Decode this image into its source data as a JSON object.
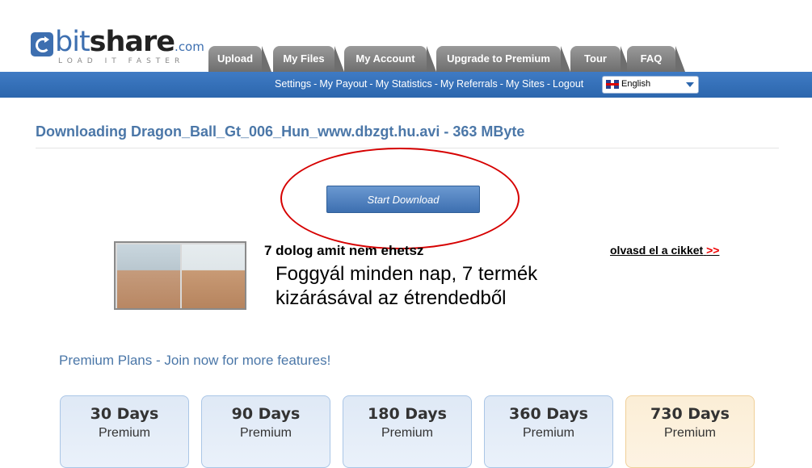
{
  "logo": {
    "light": "bit",
    "strong": "share",
    "domain": ".com",
    "tagline": "LOAD IT FASTER"
  },
  "tabs": [
    {
      "label": "Upload"
    },
    {
      "label": "My Files"
    },
    {
      "label": "My Account"
    },
    {
      "label": "Upgrade to Premium"
    },
    {
      "label": "Tour"
    },
    {
      "label": "FAQ"
    }
  ],
  "sublinks": [
    {
      "label": "Settings"
    },
    {
      "label": "My Payout"
    },
    {
      "label": "My Statistics"
    },
    {
      "label": "My Referrals"
    },
    {
      "label": "My Sites"
    },
    {
      "label": "Logout"
    }
  ],
  "sublink_separator": "-",
  "language": {
    "selected": "English"
  },
  "download": {
    "title": "Downloading Dragon_Ball_Gt_006_Hun_www.dbzgt.hu.avi - 363 MByte",
    "start_label": "Start Download"
  },
  "ad": {
    "heading": "7 dolog amit nem ehetsz",
    "text": "Foggyál minden nap, 7 termék kizárásával az étrendedből",
    "more_label": "olvasd el a cikket",
    "more_arrows": ">>"
  },
  "premium": {
    "title": "Premium Plans - Join now for more features!",
    "plans": [
      {
        "days": "30 Days",
        "sub": "Premium"
      },
      {
        "days": "90 Days",
        "sub": "Premium"
      },
      {
        "days": "180 Days",
        "sub": "Premium"
      },
      {
        "days": "360 Days",
        "sub": "Premium"
      },
      {
        "days": "730 Days",
        "sub": "Premium"
      }
    ]
  },
  "colors": {
    "brand_blue": "#3d6fb0",
    "title_blue": "#4b77a8",
    "annotation_red": "#d60000"
  }
}
